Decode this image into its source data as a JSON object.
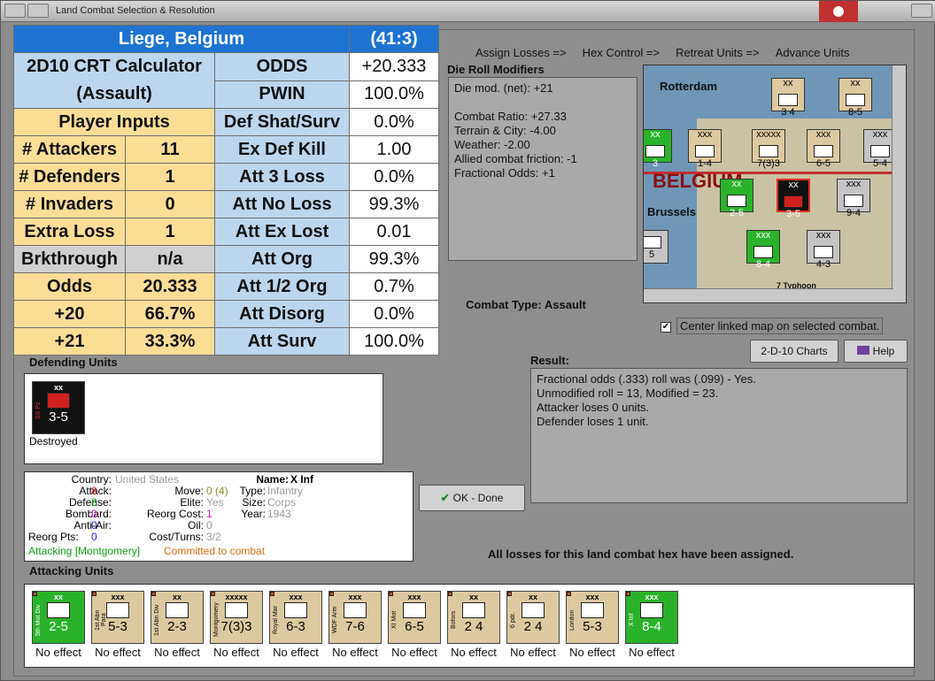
{
  "window": {
    "title": "Land Combat Selection & Resolution"
  },
  "nav": [
    "Assign Losses =>",
    "Hex Control =>",
    "Retreat Units =>",
    "Advance Units"
  ],
  "crt": {
    "location": "Liege, Belgium",
    "hex": "(41:3)",
    "calc_title": "2D10 CRT Calculator",
    "calc_subtitle": "(Assault)",
    "player_inputs": "Player Inputs",
    "left_rows": [
      {
        "label": "# Attackers",
        "value": "11"
      },
      {
        "label": "# Defenders",
        "value": "1"
      },
      {
        "label": "# Invaders",
        "value": "0"
      },
      {
        "label": "Extra Loss",
        "value": "1"
      },
      {
        "label": "Brkthrough",
        "value": "n/a"
      },
      {
        "label": "Odds",
        "value": "20.333"
      },
      {
        "label": "+20",
        "value": "66.7%"
      },
      {
        "label": "+21",
        "value": "33.3%"
      }
    ],
    "right_rows": [
      {
        "label": "ODDS",
        "value": "+20.333"
      },
      {
        "label": "PWIN",
        "value": "100.0%"
      },
      {
        "label": "Def Shat/Surv",
        "value": "0.0%"
      },
      {
        "label": "Ex Def Kill",
        "value": "1.00"
      },
      {
        "label": "Att 3 Loss",
        "value": "0.0%"
      },
      {
        "label": "Att No Loss",
        "value": "99.3%"
      },
      {
        "label": "Att Ex Lost",
        "value": "0.01"
      },
      {
        "label": "Att Org",
        "value": "99.3%"
      },
      {
        "label": "Att 1/2 Org",
        "value": "0.7%"
      },
      {
        "label": "Att Disorg",
        "value": "0.0%"
      },
      {
        "label": "Att Surv",
        "value": "100.0%"
      }
    ]
  },
  "die_roll": {
    "heading": "Die Roll Modifiers",
    "lines": [
      "Die mod. (net): +21",
      "",
      "Combat Ratio: +27.33",
      "Terrain & City: -4.00",
      "Weather: -2.00",
      "Allied combat friction: -1",
      "Fractional Odds: +1"
    ]
  },
  "combat_type": {
    "label": "Combat Type:",
    "value": "Assault"
  },
  "map": {
    "labels": {
      "rotterdam": "Rotterdam",
      "belgium": "BELGIUM",
      "brussels": "Brussels",
      "typhoon": "7 Typhoon"
    },
    "counters": [
      {
        "top": "xx",
        "name": "",
        "str": "3 4"
      },
      {
        "top": "xx",
        "name": "",
        "str": "8-5"
      },
      {
        "top": "xx",
        "name": "",
        "str": "3"
      },
      {
        "top": "xxx",
        "name": "",
        "str": "1-4"
      },
      {
        "top": "xxxxx",
        "name": "",
        "str": "7(3)3"
      },
      {
        "top": "xxx",
        "name": "",
        "str": "6-5"
      },
      {
        "top": "xxx",
        "name": "",
        "str": "5-4"
      },
      {
        "top": "xx",
        "name": "",
        "str": "2-5"
      },
      {
        "top": "xx",
        "name": "",
        "str": "3-5"
      },
      {
        "top": "xxx",
        "name": "",
        "str": "9-4"
      },
      {
        "top": "xxx",
        "name": "",
        "str": "8-4"
      },
      {
        "top": "xxx",
        "name": "",
        "str": "4-3"
      },
      {
        "top": "",
        "name": "",
        "str": "5"
      }
    ]
  },
  "center_map": {
    "checked": "✔",
    "label": "Center linked map on selected combat."
  },
  "buttons": {
    "charts": "2-D-10 Charts",
    "help": "Help",
    "ok": "OK - Done"
  },
  "result": {
    "heading": "Result:",
    "lines": [
      "Fractional odds (.333) roll was (.099)  - Yes.",
      "Unmodified roll = 13, Modified = 23.",
      "Attacker loses 0 units.",
      "Defender loses 1 unit."
    ]
  },
  "defending": {
    "heading": "Defending Units",
    "unit": {
      "size": "xx",
      "side": "SS Pz",
      "str": "3-5",
      "status": "Destroyed"
    }
  },
  "unit_info": {
    "country_label": "Country:",
    "country": "United States",
    "attack_label": "Attack:",
    "attack": "8",
    "defense_label": "Defense:",
    "defense": "8",
    "bombard_label": "Bombard:",
    "bombard": "0",
    "antiair_label": "Anti-Air:",
    "antiair": "0",
    "reorg_label": "Reorg Pts:",
    "reorg": "0",
    "move_label": "Move:",
    "move": "0 (4)",
    "elite_label": "Elite:",
    "elite": "Yes",
    "reorgcost_label": "Reorg Cost:",
    "reorgcost": "1",
    "oil_label": "Oil:",
    "oil": "0",
    "cost_label": "Cost/Turns:",
    "cost": "3/2",
    "name_label": "Name:",
    "name": "X Inf",
    "type_label": "Type:",
    "type": "Infantry",
    "size_label": "Size:",
    "size": "Corps",
    "year_label": "Year:",
    "year": "1943",
    "attacking": "Attacking [Montgomery]",
    "committed": "Committed to combat"
  },
  "losses_msg": "All losses for this land combat hex have been assigned.",
  "attacking": {
    "heading": "Attacking Units",
    "units": [
      {
        "size": "xx",
        "side": "5th Mot Div",
        "str": "2-5",
        "color": "grn",
        "result": "No effect"
      },
      {
        "size": "xxx",
        "side": "1st Abn Para",
        "str": "5-3",
        "color": "tan",
        "result": "No effect"
      },
      {
        "size": "xx",
        "side": "1st Abn Div",
        "str": "2-3",
        "color": "tan",
        "result": "No effect"
      },
      {
        "size": "xxxxx",
        "side": "Montgomery",
        "str": "7(3)3",
        "color": "tan",
        "result": "No effect"
      },
      {
        "size": "xxx",
        "side": "Royal Mar",
        "str": "6-3",
        "color": "tan",
        "result": "No effect"
      },
      {
        "size": "xxx",
        "side": "WDF Arm",
        "str": "7-6",
        "color": "tan",
        "result": "No effect"
      },
      {
        "size": "xxx",
        "side": "XI Mot",
        "str": "6-5",
        "color": "tan",
        "result": "No effect"
      },
      {
        "size": "xx",
        "side": "Bofors",
        "str": "2 4",
        "color": "tan",
        "result": "No effect"
      },
      {
        "size": "xx",
        "side": "6 pdr.",
        "str": "2 4",
        "color": "tan",
        "result": "No effect"
      },
      {
        "size": "xxx",
        "side": "London",
        "str": "5-3",
        "color": "tan",
        "result": "No effect"
      },
      {
        "size": "xxx",
        "side": "X Inf",
        "str": "8-4",
        "color": "grn",
        "result": "No effect"
      }
    ]
  }
}
